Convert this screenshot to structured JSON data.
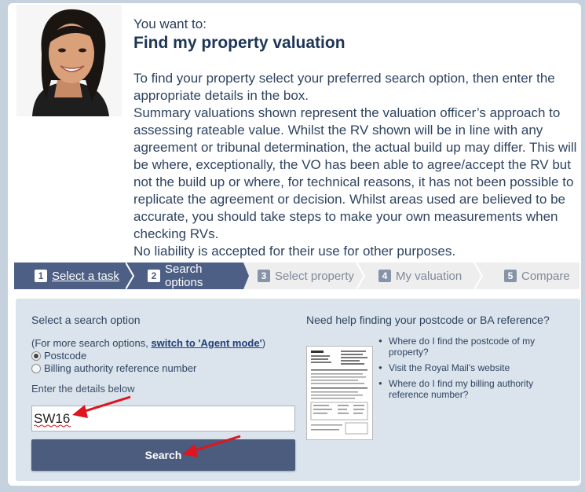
{
  "intro": {
    "pre_title": "You want to:",
    "title": "Find my property valuation",
    "paragraph_1": "To find your property select your preferred search option, then enter the appropriate details in the box.",
    "paragraph_2": "Summary valuations shown represent the valuation officer’s approach to assessing rateable value. Whilst the RV shown will be in line with any agreement or tribunal determination, the actual build up may differ. This will be where, exceptionally, the VO has been able to agree/accept the RV but not the build up or where, for technical reasons, it has not been possible to replicate the agreement or decision. Whilst areas used are believed to be accurate, you should take steps to make your own measurements when checking RVs.",
    "paragraph_3": "No liability is accepted for their use for other purposes."
  },
  "steps": [
    {
      "num": "1",
      "label": "Select a task",
      "state": "done"
    },
    {
      "num": "2",
      "label": "Search options",
      "state": "current"
    },
    {
      "num": "3",
      "label": "Select property",
      "state": "upcoming"
    },
    {
      "num": "4",
      "label": "My valuation",
      "state": "upcoming"
    },
    {
      "num": "5",
      "label": "Compare",
      "state": "upcoming"
    }
  ],
  "search": {
    "heading": "Select a search option",
    "more_options_prefix": "(For more search options, ",
    "more_options_link": "switch to 'Agent mode'",
    "more_options_suffix": ")",
    "options": [
      {
        "label": "Postcode",
        "checked": true
      },
      {
        "label": "Billing authority reference number",
        "checked": false
      }
    ],
    "details_label": "Enter the details below",
    "input_value": "SW16",
    "button_label": "Search"
  },
  "help": {
    "heading": "Need help finding your postcode or BA reference?",
    "links": [
      "Where do I find the postcode of my property?",
      "Visit the Royal Mail's website",
      "Where do I find my billing authority reference number?"
    ]
  },
  "colors": {
    "page_bg": "#c5d2de",
    "step_active": "#4d5f84",
    "search_panel": "#dbe4ec",
    "button": "#4b5c7e",
    "arrow": "#e0141e"
  }
}
